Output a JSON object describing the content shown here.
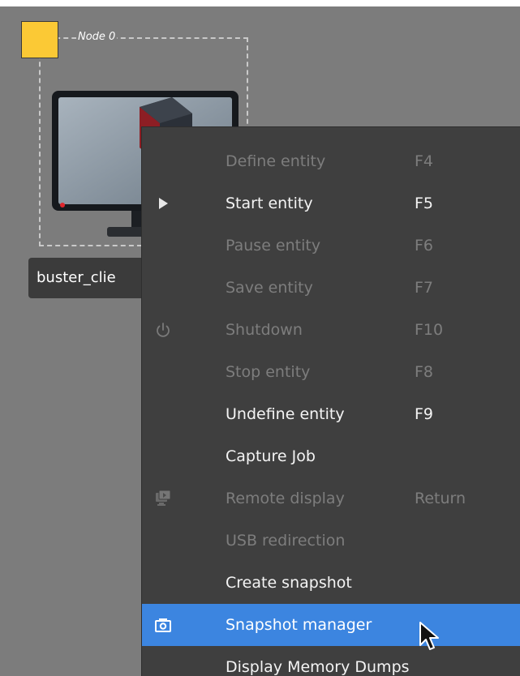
{
  "canvas": {
    "node": {
      "label": "Node 0",
      "color": "#fbc935"
    },
    "entity": {
      "label": "buster_clie",
      "icon": "desktop-monitor-icon"
    }
  },
  "context_menu": {
    "items": [
      {
        "label": "Define entity",
        "shortcut": "F4",
        "enabled": false,
        "icon": ""
      },
      {
        "label": "Start entity",
        "shortcut": "F5",
        "enabled": true,
        "icon": "play-icon"
      },
      {
        "label": "Pause entity",
        "shortcut": "F6",
        "enabled": false,
        "icon": ""
      },
      {
        "label": "Save entity",
        "shortcut": "F7",
        "enabled": false,
        "icon": ""
      },
      {
        "label": "Shutdown",
        "shortcut": "F10",
        "enabled": false,
        "icon": "power-icon"
      },
      {
        "label": "Stop entity",
        "shortcut": "F8",
        "enabled": false,
        "icon": ""
      },
      {
        "label": "Undefine entity",
        "shortcut": "F9",
        "enabled": true,
        "icon": ""
      },
      {
        "label": "Capture Job",
        "shortcut": "",
        "enabled": true,
        "icon": ""
      },
      {
        "label": "Remote display",
        "shortcut": "Return",
        "enabled": false,
        "icon": "remote-display-icon"
      },
      {
        "label": "USB redirection",
        "shortcut": "",
        "enabled": false,
        "icon": ""
      },
      {
        "label": "Create snapshot",
        "shortcut": "",
        "enabled": true,
        "icon": ""
      },
      {
        "label": "Snapshot manager",
        "shortcut": "",
        "enabled": true,
        "highlighted": true,
        "icon": "camera-icon"
      },
      {
        "label": "Display Memory Dumps",
        "shortcut": "",
        "enabled": true,
        "icon": ""
      }
    ],
    "colors": {
      "background": "#3f3f3f",
      "highlight": "#3c85e0",
      "enabled_text": "#f4f4f4",
      "disabled_text": "#7d7d7d"
    }
  }
}
